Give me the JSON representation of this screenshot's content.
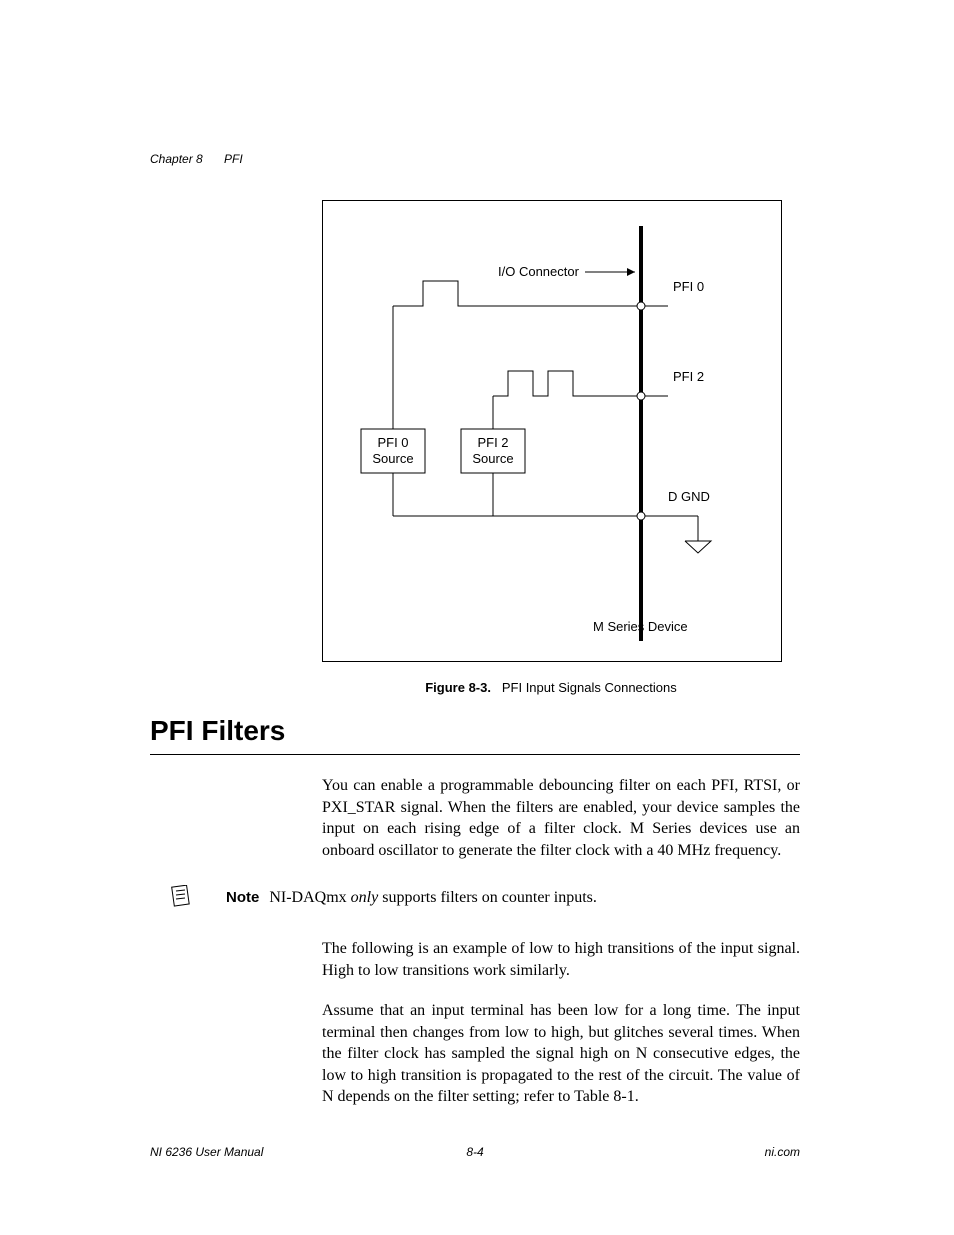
{
  "header": {
    "chapter": "Chapter 8",
    "title": "PFI"
  },
  "figure": {
    "io_connector": "I/O Connector",
    "pfi0": "PFI 0",
    "pfi2": "PFI 2",
    "pfi0_source_l1": "PFI 0",
    "pfi0_source_l2": "Source",
    "pfi2_source_l1": "PFI 2",
    "pfi2_source_l2": "Source",
    "dgnd": "D GND",
    "device": "M Series Device",
    "caption_bold": "Figure 8-3.",
    "caption_rest": "PFI Input Signals Connections"
  },
  "section_heading": "PFI Filters",
  "para1": "You can enable a programmable debouncing filter on each PFI, RTSI, or PXI_STAR signal. When the filters are enabled, your device samples the input on each rising edge of a filter clock. M Series devices use an onboard oscillator to generate the filter clock with a 40 MHz frequency.",
  "note": {
    "label": "Note",
    "pre": "NI-DAQmx ",
    "italic": "only",
    "post": " supports filters on counter inputs."
  },
  "para2": "The following is an example of low to high transitions of the input signal. High to low transitions work similarly.",
  "para3": "Assume that an input terminal has been low for a long time. The input terminal then changes from low to high, but glitches several times. When the filter clock has sampled the signal high on N consecutive edges, the low to high transition is propagated to the rest of the circuit. The value of N depends on the filter setting; refer to Table 8-1.",
  "footer": {
    "left": "NI 6236 User Manual",
    "center": "8-4",
    "right": "ni.com"
  }
}
